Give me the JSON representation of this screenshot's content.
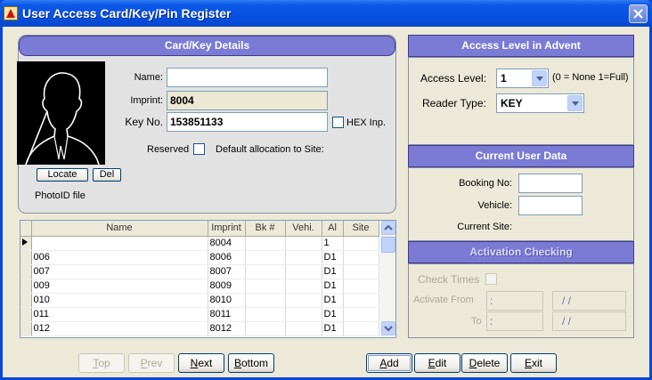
{
  "window": {
    "title": "User Access Card/Key/Pin Register"
  },
  "card_details": {
    "header": "Card/Key Details",
    "name_label": "Name:",
    "name_value": "",
    "imprint_label": "Imprint:",
    "imprint_value": "8004",
    "keyno_label": "Key No.",
    "keyno_value": "153851133",
    "hex_label": "HEX Inp.",
    "reserved_label": "Reserved",
    "default_alloc_label": "Default allocation to Site:",
    "locate_button": "Locate",
    "del_button": "Del",
    "photoid_label": "PhotoID file"
  },
  "grid": {
    "columns": [
      "Name",
      "Imprint",
      "Bk #",
      "Vehi.",
      "Al",
      "Site"
    ],
    "rows": [
      {
        "name": "",
        "imprint": "8004",
        "bk": "",
        "vehi": "",
        "al": "1",
        "site": ""
      },
      {
        "name": "006",
        "imprint": "8006",
        "bk": "",
        "vehi": "",
        "al": "D1",
        "site": ""
      },
      {
        "name": "007",
        "imprint": "8007",
        "bk": "",
        "vehi": "",
        "al": "D1",
        "site": ""
      },
      {
        "name": "009",
        "imprint": "8009",
        "bk": "",
        "vehi": "",
        "al": "D1",
        "site": ""
      },
      {
        "name": "010",
        "imprint": "8010",
        "bk": "",
        "vehi": "",
        "al": "D1",
        "site": ""
      },
      {
        "name": "011",
        "imprint": "8011",
        "bk": "",
        "vehi": "",
        "al": "D1",
        "site": ""
      },
      {
        "name": "012",
        "imprint": "8012",
        "bk": "",
        "vehi": "",
        "al": "D1",
        "site": ""
      }
    ]
  },
  "access_level": {
    "header": "Access Level in Advent",
    "level_label": "Access Level:",
    "level_value": "1",
    "level_hint": "(0 = None  1=Full)",
    "reader_label": "Reader Type:",
    "reader_value": "KEY"
  },
  "current_user": {
    "header": "Current User Data",
    "booking_label": "Booking No:",
    "vehicle_label": "Vehicle:",
    "site_label": "Current Site:"
  },
  "activation": {
    "header": "Activation Checking",
    "check_times_label": "Check Times",
    "activate_from_label": "Activate From",
    "to_label": "To",
    "time_placeholder": ":",
    "date_placeholder": "/  /"
  },
  "nav_buttons": {
    "top_u": "T",
    "top_rest": "op",
    "prev_u": "P",
    "prev_rest": "rev",
    "next_u": "N",
    "next_rest": "ext",
    "bottom_u": "B",
    "bottom_rest": "ottom"
  },
  "action_buttons": {
    "add_u": "A",
    "add_rest": "dd",
    "edit_u": "E",
    "edit_rest": "dit",
    "delete_u": "D",
    "delete_rest": "elete",
    "exit_u": "E",
    "exit_rest": "xit"
  }
}
